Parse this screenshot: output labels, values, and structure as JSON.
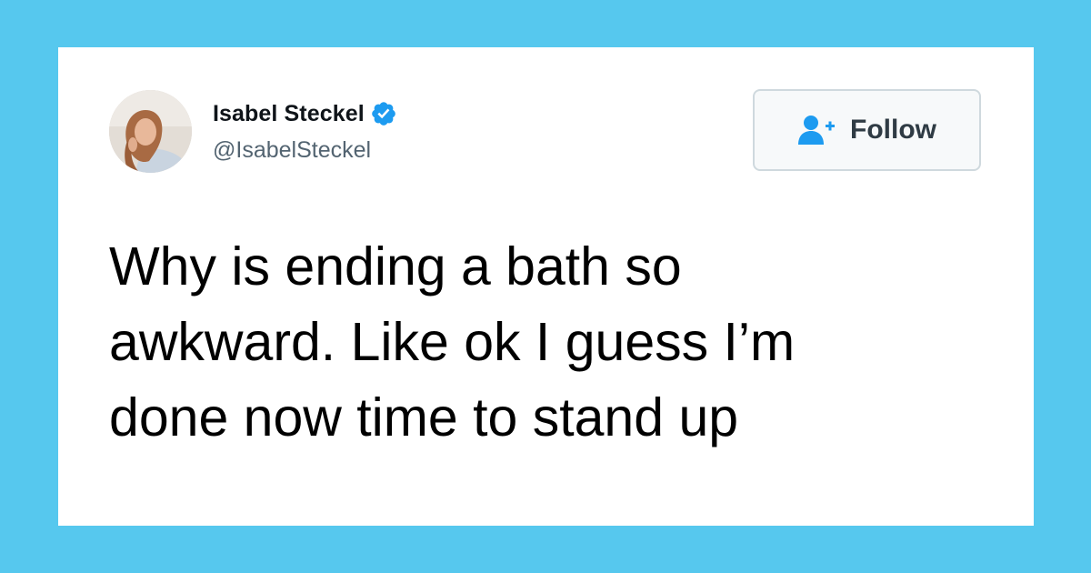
{
  "background_color": "#56c8ee",
  "tweet": {
    "author": {
      "display_name": "Isabel Steckel",
      "handle": "@IsabelSteckel",
      "verified": true,
      "verified_color": "#1d9bf0"
    },
    "follow_button": {
      "label": "Follow",
      "icon": "add-user-icon",
      "icon_color": "#1d9bf0"
    },
    "text": "Why is ending a bath so\nawkward. Like ok I guess I’m\ndone now time to stand up"
  }
}
